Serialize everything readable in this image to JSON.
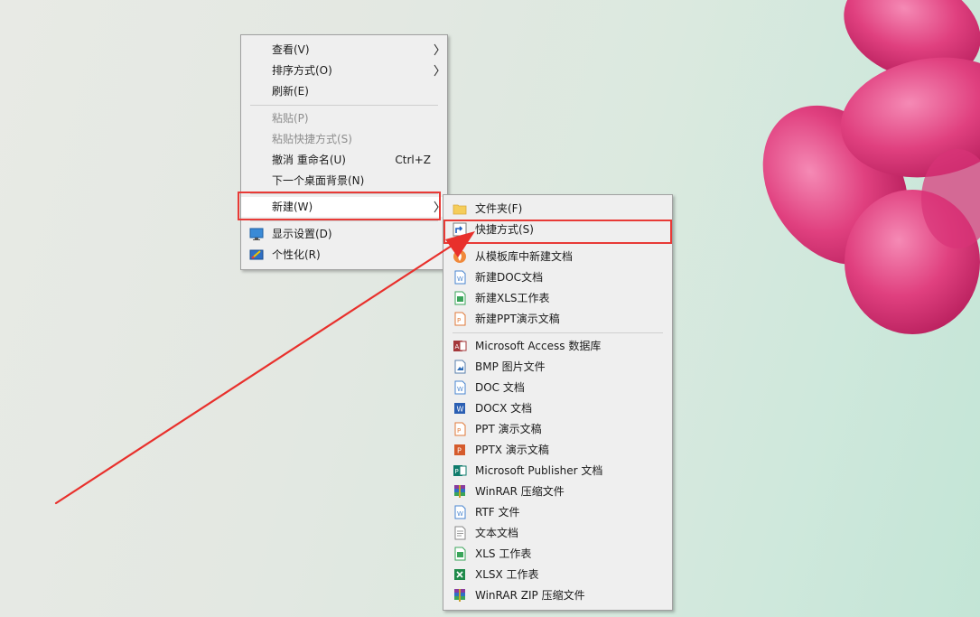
{
  "main_menu": {
    "items": [
      {
        "label": "查看(V)"
      },
      {
        "label": "排序方式(O)"
      },
      {
        "label": "刷新(E)"
      },
      {
        "label": "粘贴(P)"
      },
      {
        "label": "粘贴快捷方式(S)"
      },
      {
        "label": "撤消 重命名(U)",
        "shortcut": "Ctrl+Z"
      },
      {
        "label": "下一个桌面背景(N)"
      },
      {
        "label": "新建(W)"
      },
      {
        "label": "显示设置(D)"
      },
      {
        "label": "个性化(R)"
      }
    ]
  },
  "sub_menu": {
    "items": [
      {
        "label": "文件夹(F)"
      },
      {
        "label": "快捷方式(S)"
      },
      {
        "label": "从模板库中新建文档"
      },
      {
        "label": "新建DOC文档"
      },
      {
        "label": "新建XLS工作表"
      },
      {
        "label": "新建PPT演示文稿"
      },
      {
        "label": "Microsoft Access 数据库"
      },
      {
        "label": "BMP 图片文件"
      },
      {
        "label": "DOC 文档"
      },
      {
        "label": "DOCX 文档"
      },
      {
        "label": "PPT 演示文稿"
      },
      {
        "label": "PPTX 演示文稿"
      },
      {
        "label": "Microsoft Publisher 文档"
      },
      {
        "label": "WinRAR 压缩文件"
      },
      {
        "label": "RTF 文件"
      },
      {
        "label": "文本文档"
      },
      {
        "label": "XLS 工作表"
      },
      {
        "label": "XLSX 工作表"
      },
      {
        "label": "WinRAR ZIP 压缩文件"
      }
    ]
  },
  "colors": {
    "highlight_box": "#e83a36",
    "annotation_arrow": "#e8302c",
    "flower": "#e0407f",
    "menu_bg": "#efefef"
  }
}
